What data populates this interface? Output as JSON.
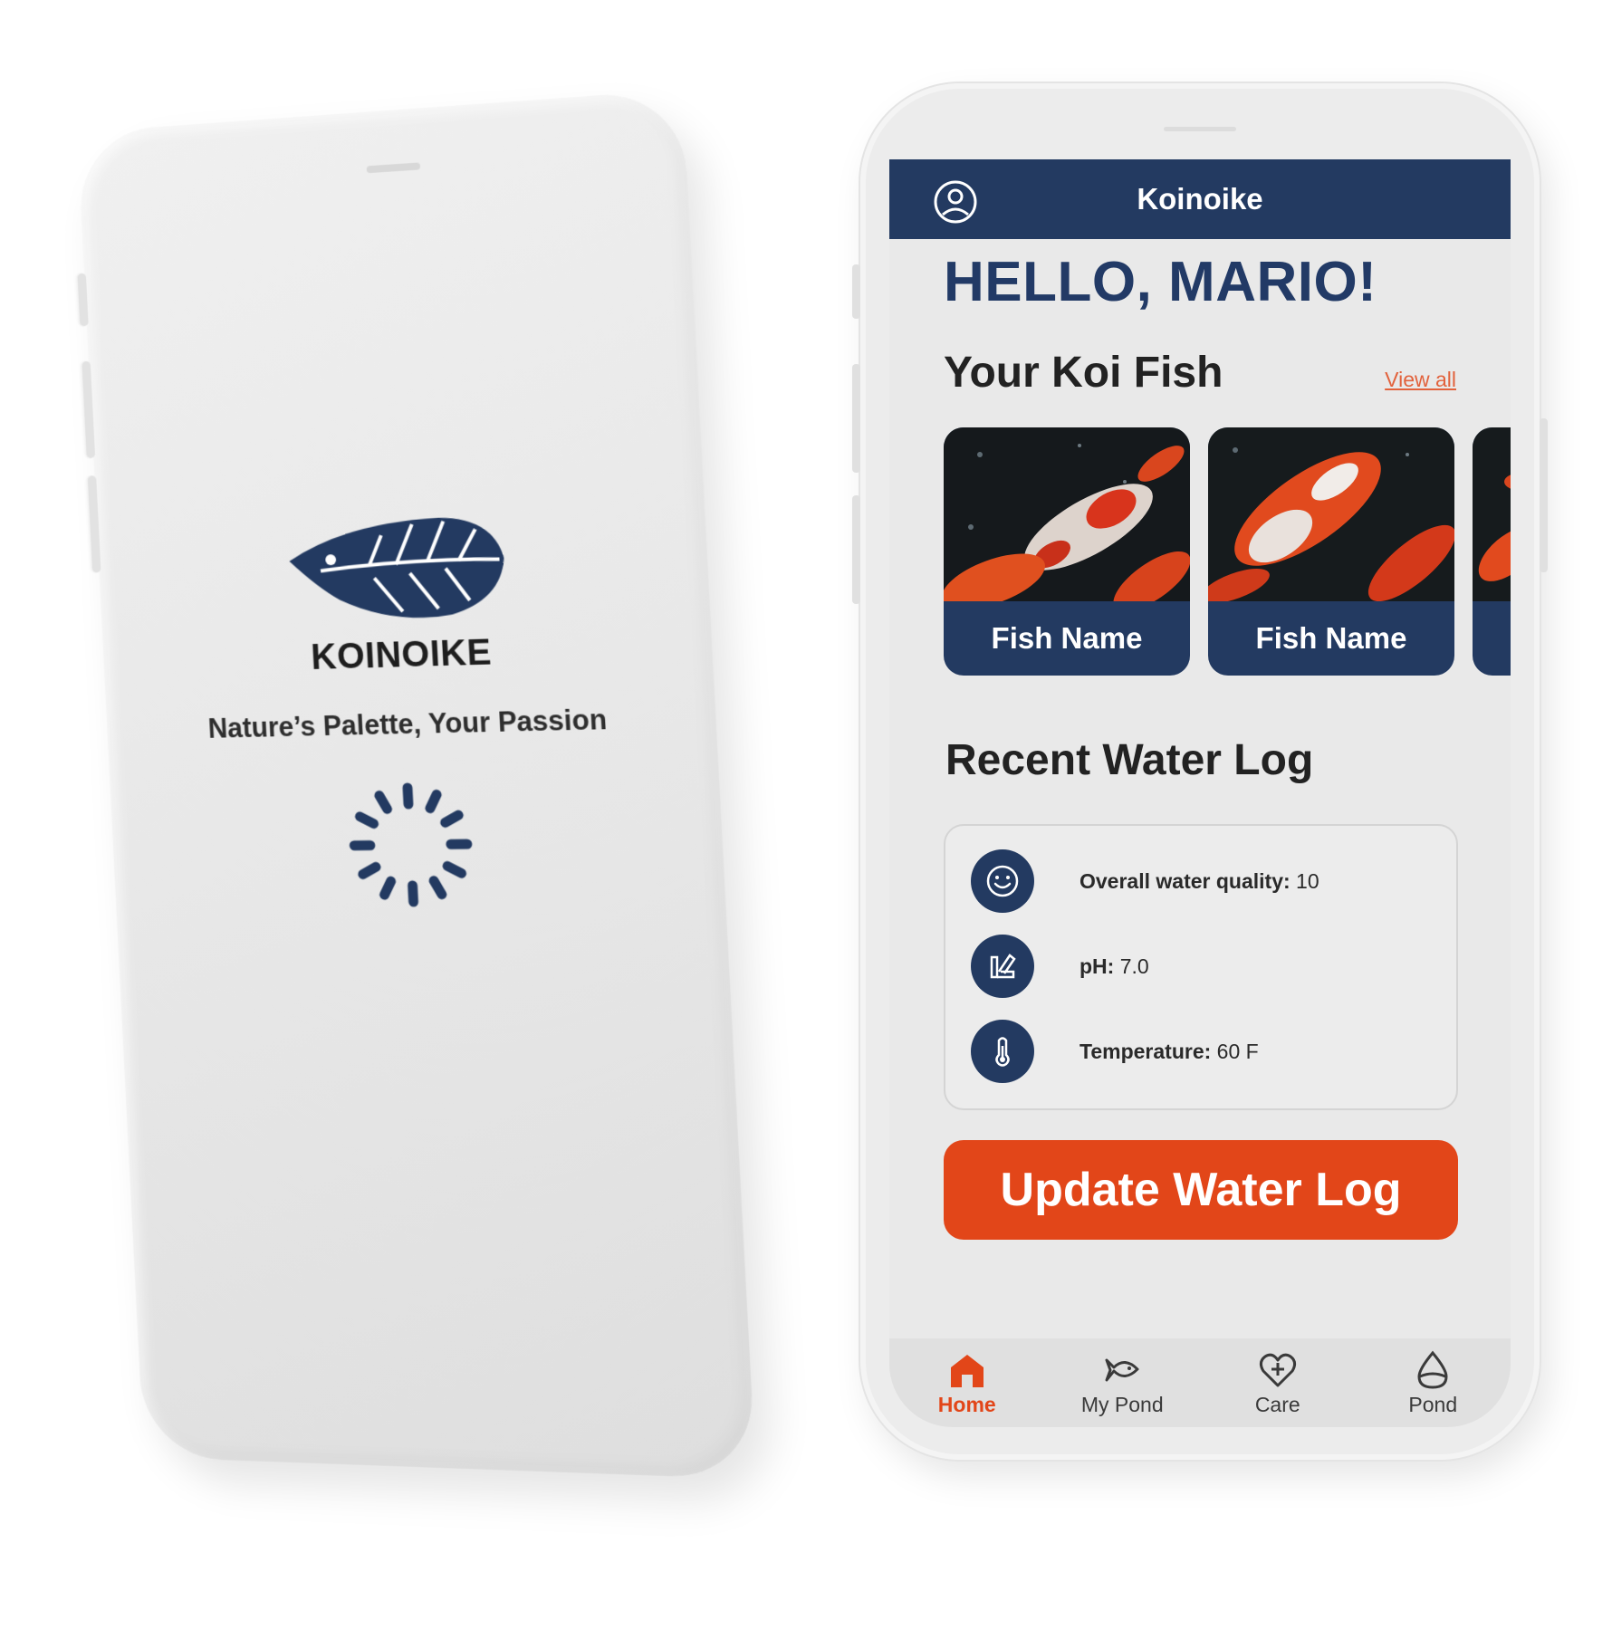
{
  "splash": {
    "brand": "KOINOIKE",
    "tagline": "Nature’s Palette, Your Passion",
    "logo_icon": "koi-leaf-logo",
    "loading_icon": "loading-spinner"
  },
  "app": {
    "title": "Koinoike",
    "profile_icon": "profile-icon",
    "greeting": "HELLO, MARIO!"
  },
  "koi_section": {
    "title": "Your Koi Fish",
    "view_all": "View all",
    "fish": [
      {
        "name": "Fish Name"
      },
      {
        "name": "Fish Name"
      },
      {
        "name": ""
      }
    ]
  },
  "water_log": {
    "title": "Recent Water Log",
    "rows": [
      {
        "icon": "smiley-icon",
        "label": "Overall water quality:",
        "value": "10"
      },
      {
        "icon": "ph-strip-icon",
        "label": "pH:",
        "value": "7.0"
      },
      {
        "icon": "thermometer-icon",
        "label": "Temperature:",
        "value": "60 F"
      }
    ],
    "update_button": "Update Water Log"
  },
  "nav": {
    "items": [
      {
        "label": "Home",
        "icon": "home-icon",
        "active": true
      },
      {
        "label": "My Pond",
        "icon": "fish-icon",
        "active": false
      },
      {
        "label": "Care",
        "icon": "heart-plus-icon",
        "active": false
      },
      {
        "label": "Pond",
        "icon": "water-drop-icon",
        "active": false
      }
    ]
  },
  "colors": {
    "navy": "#233a61",
    "accent": "#e24619",
    "link": "#e2623c",
    "device": "#ececec"
  }
}
